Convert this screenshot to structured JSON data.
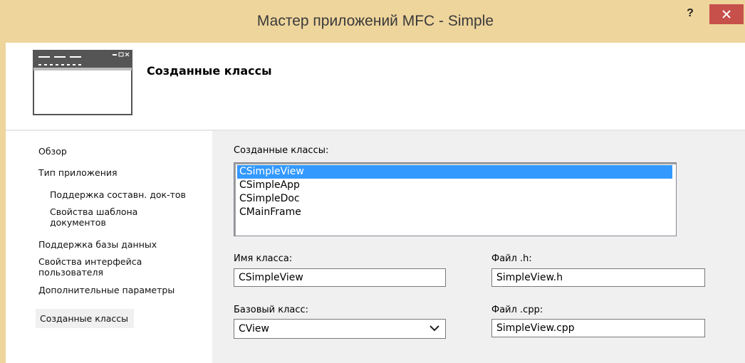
{
  "window": {
    "title": "Мастер приложений MFC - Simple",
    "help_label": "?",
    "close_icon": "close-icon"
  },
  "header": {
    "title": "Созданные классы",
    "icon": "application-window-icon"
  },
  "sidebar": {
    "items": [
      {
        "label": "Обзор"
      },
      {
        "label": "Тип приложения"
      },
      {
        "label": "Поддержка составн. док-тов"
      },
      {
        "label": "Свойства шаблона документов"
      },
      {
        "label": "Поддержка базы данных"
      },
      {
        "label": "Свойства интерфейса пользователя"
      },
      {
        "label": "Дополнительные параметры"
      },
      {
        "label": "Созданные классы"
      }
    ]
  },
  "main": {
    "classes_label": "Созданные классы:",
    "classes": [
      {
        "name": "CSimpleView",
        "selected": true
      },
      {
        "name": "CSimpleApp",
        "selected": false
      },
      {
        "name": "CSimpleDoc",
        "selected": false
      },
      {
        "name": "CMainFrame",
        "selected": false
      }
    ],
    "class_name_label": "Имя класса:",
    "class_name_value": "CSimpleView",
    "h_file_label": "Файл .h:",
    "h_file_value": "SimpleView.h",
    "base_class_label": "Базовый класс:",
    "base_class_value": "CView",
    "cpp_file_label": "Файл .cpp:",
    "cpp_file_value": "SimpleView.cpp"
  },
  "colors": {
    "title_bar": "#eed59c",
    "close_button": "#c7504b",
    "selection": "#3399ff",
    "content_bg": "#f0f0f0"
  }
}
